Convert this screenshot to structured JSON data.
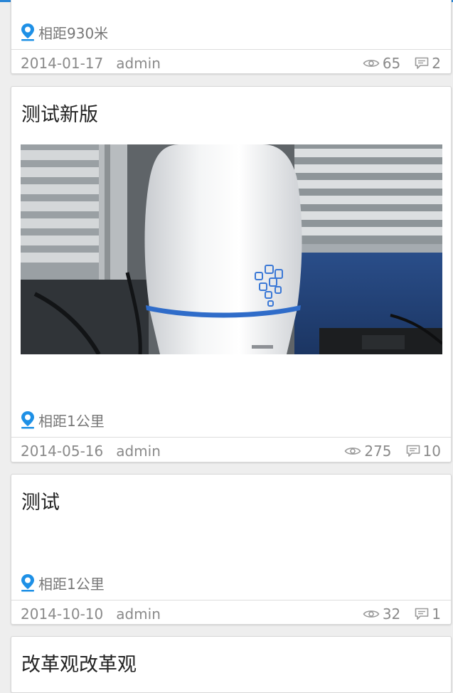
{
  "colors": {
    "accent": "#2a86d6",
    "pin": "#1e90e6",
    "meta_text": "#8a8a8a"
  },
  "posts": [
    {
      "title": "",
      "distance": "相距930米",
      "date": "2014-01-17",
      "author": "admin",
      "views": "65",
      "comments": "2"
    },
    {
      "title": "测试新版",
      "has_image": true,
      "image_subject": "white humidifier in office",
      "distance": "相距1公里",
      "date": "2014-05-16",
      "author": "admin",
      "views": "275",
      "comments": "10"
    },
    {
      "title": "测试",
      "distance": "相距1公里",
      "date": "2014-10-10",
      "author": "admin",
      "views": "32",
      "comments": "1"
    },
    {
      "title": "改革观改革观"
    }
  ],
  "icons": {
    "location": "map-pin-icon",
    "views": "eye-icon",
    "comments": "comment-icon"
  }
}
